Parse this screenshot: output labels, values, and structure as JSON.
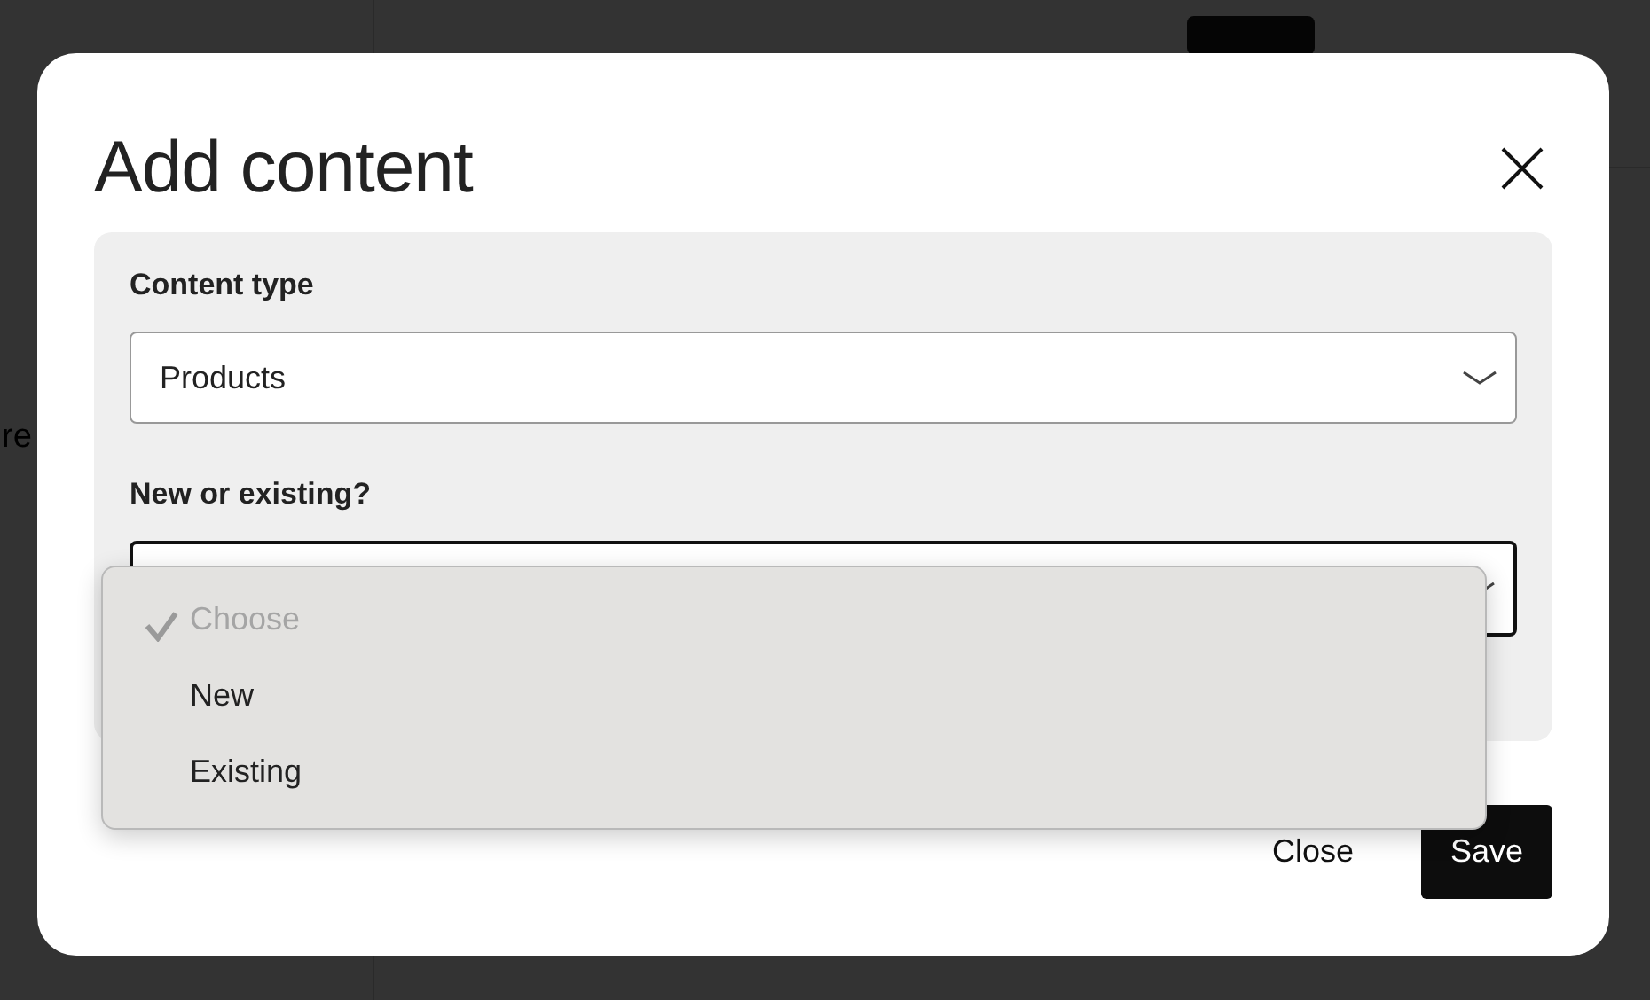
{
  "background": {
    "side_text": "re"
  },
  "dialog": {
    "title": "Add content",
    "fields": [
      {
        "label": "Content type",
        "value": "Products",
        "focused": false
      },
      {
        "label": "New or existing?",
        "focused": true
      }
    ],
    "menu": {
      "options": [
        {
          "label": "Choose",
          "selected": true,
          "disabled": true
        },
        {
          "label": "New",
          "selected": false,
          "disabled": false
        },
        {
          "label": "Existing",
          "selected": false,
          "disabled": false
        }
      ]
    },
    "buttons": [
      {
        "label": "Close",
        "kind": "plain"
      },
      {
        "label": "Save",
        "kind": "primary"
      }
    ]
  }
}
